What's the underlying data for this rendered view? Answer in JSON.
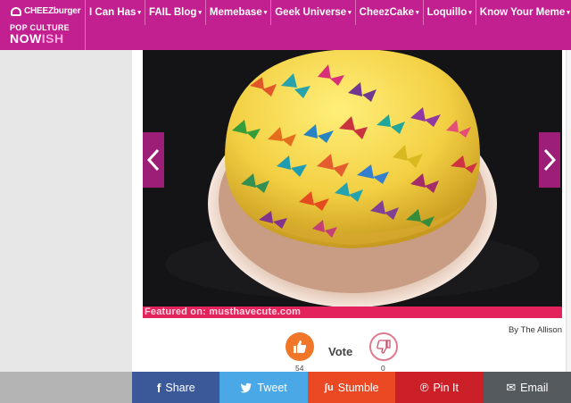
{
  "brand": {
    "logo_text": "CHEEZburger",
    "site_line1": "POP CULTURE",
    "site_line2_a": "NOW",
    "site_line2_b": "ISH",
    "color": "#c21f91"
  },
  "nav": {
    "items": [
      {
        "label": "I Can Has"
      },
      {
        "label": "FAIL Blog"
      },
      {
        "label": "Memebase"
      },
      {
        "label": "Geek Universe"
      },
      {
        "label": "CheezCake"
      },
      {
        "label": "Loquillo"
      },
      {
        "label": "Know Your Meme"
      }
    ],
    "caret": "▾"
  },
  "post": {
    "watermark": "Featured on: musthavecute.com",
    "credit": "By The Allison"
  },
  "carousel": {
    "prev_icon": "chevron-left-icon",
    "next_icon": "chevron-right-icon"
  },
  "vote": {
    "label": "Vote",
    "up_count": "54",
    "down_count": "0",
    "up_color": "#f0762a"
  },
  "share": [
    {
      "label": "Share",
      "icon": "f",
      "color": "#3b5998"
    },
    {
      "label": "Tweet",
      "icon": "🐦",
      "color": "#4aa8e6"
    },
    {
      "label": "Stumble",
      "icon": "ʃu",
      "color": "#eb4924"
    },
    {
      "label": "Pin It",
      "icon": "℗",
      "color": "#cb2027"
    },
    {
      "label": "Email",
      "icon": "✉",
      "color": "#555a5f"
    }
  ]
}
